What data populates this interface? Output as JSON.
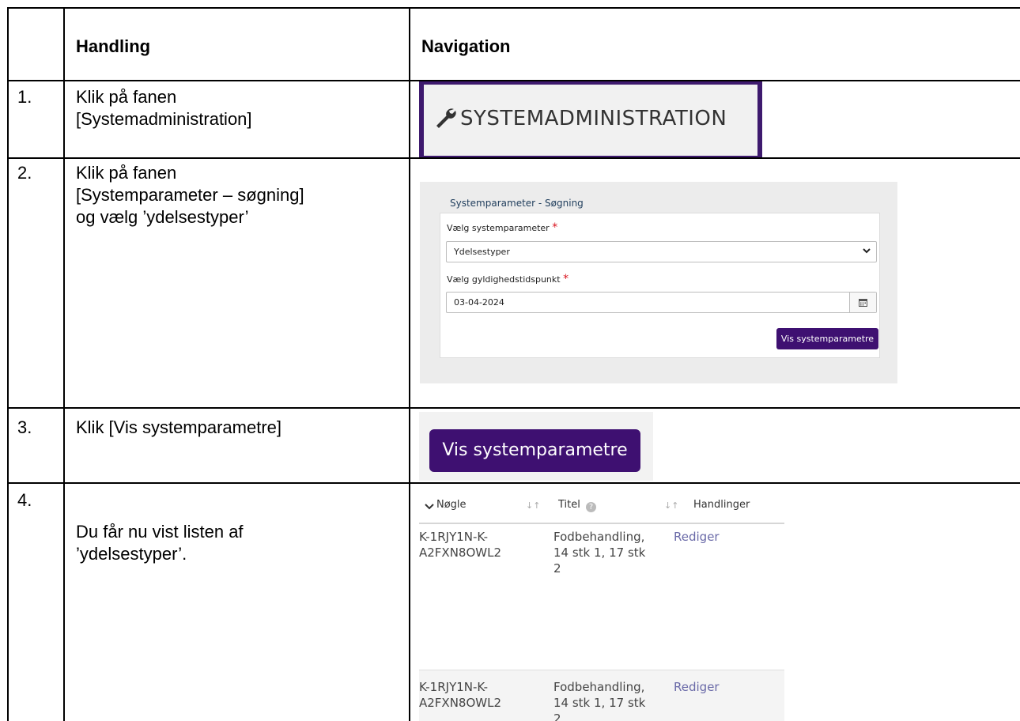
{
  "table": {
    "headers": {
      "col1": "",
      "col2": "Handling",
      "col3": "Navigation"
    },
    "rows": [
      {
        "num": "1.",
        "action": [
          "Klik på fanen",
          "[Systemadministration]"
        ]
      },
      {
        "num": "2.",
        "action": [
          "Klik på fanen",
          "[Systemparameter – søgning]",
          "og vælg ’ydelsestyper’"
        ]
      },
      {
        "num": "3.",
        "action": [
          "Klik [Vis systemparametre]"
        ]
      },
      {
        "num": "4.",
        "action": [
          "Du får nu vist listen af",
          "’ydelsestyper’."
        ]
      }
    ]
  },
  "tab_screenshot": {
    "label": "SYSTEMADMINISTRATION",
    "icon": "wrench-icon",
    "accent": "#3e1a6e"
  },
  "form_screenshot": {
    "title": "Systemparameter - Søgning",
    "param_label": "Vælg systemparameter",
    "param_value": "Ydelsestyper",
    "date_label": "Vælg gyldighedstidspunkt",
    "date_value": "03-04-2024",
    "required_mark": "*",
    "button_label": "Vis systemparametre",
    "button_color": "#3e1071"
  },
  "button_screenshot": {
    "label": "Vis systemparametre"
  },
  "list_screenshot": {
    "columns": [
      "Nøgle",
      "Titel",
      "Handlinger"
    ],
    "rows": [
      {
        "key": [
          "K-1RJY1N-K-",
          "A2FXN8OWL2"
        ],
        "title": [
          "Fodbehandling,",
          "14 stk 1, 17 stk",
          "2"
        ],
        "action": "Rediger"
      },
      {
        "key": [
          "K-1RJY1N-K-",
          "A2FXN8OWL2"
        ],
        "title": [
          "Fodbehandling,",
          "14 stk 1, 17 stk",
          "2"
        ],
        "action": "Rediger"
      }
    ]
  }
}
